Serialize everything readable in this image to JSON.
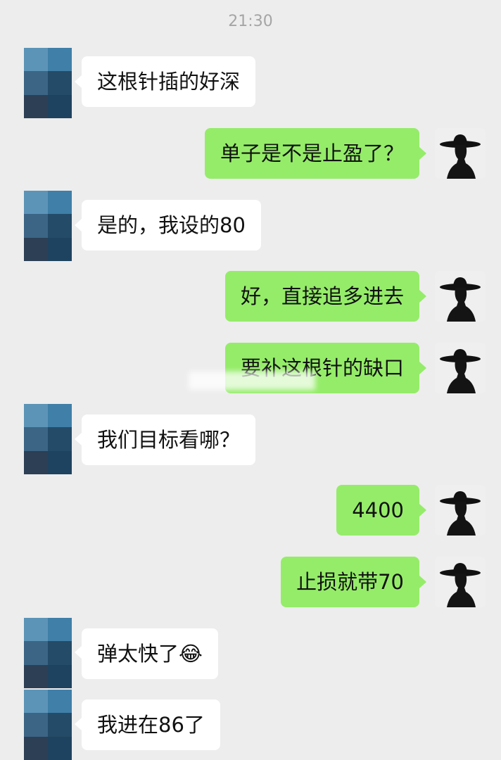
{
  "chat": {
    "timestamp": "21:30",
    "messages": [
      {
        "side": "left",
        "text": "这根针插的好深"
      },
      {
        "side": "right",
        "text": "单子是不是止盈了？"
      },
      {
        "side": "left",
        "text": "是的，我设的80"
      },
      {
        "side": "right",
        "text": "好，直接追多进去"
      },
      {
        "side": "right",
        "text": "要补这根针的缺口"
      },
      {
        "side": "left",
        "text": "我们目标看哪？"
      },
      {
        "side": "right",
        "text": "4400"
      },
      {
        "side": "right",
        "text": "止损就带70"
      },
      {
        "side": "left",
        "text": "弹太快了😂"
      },
      {
        "side": "left",
        "text": "我进在86了"
      }
    ]
  },
  "colors": {
    "background": "#ededed",
    "bubble_outgoing": "#95ec69",
    "bubble_incoming": "#ffffff"
  },
  "icons": {
    "contact_avatar": "pixelated-blue-avatar-icon",
    "self_avatar": "hat-silhouette-avatar-icon"
  }
}
